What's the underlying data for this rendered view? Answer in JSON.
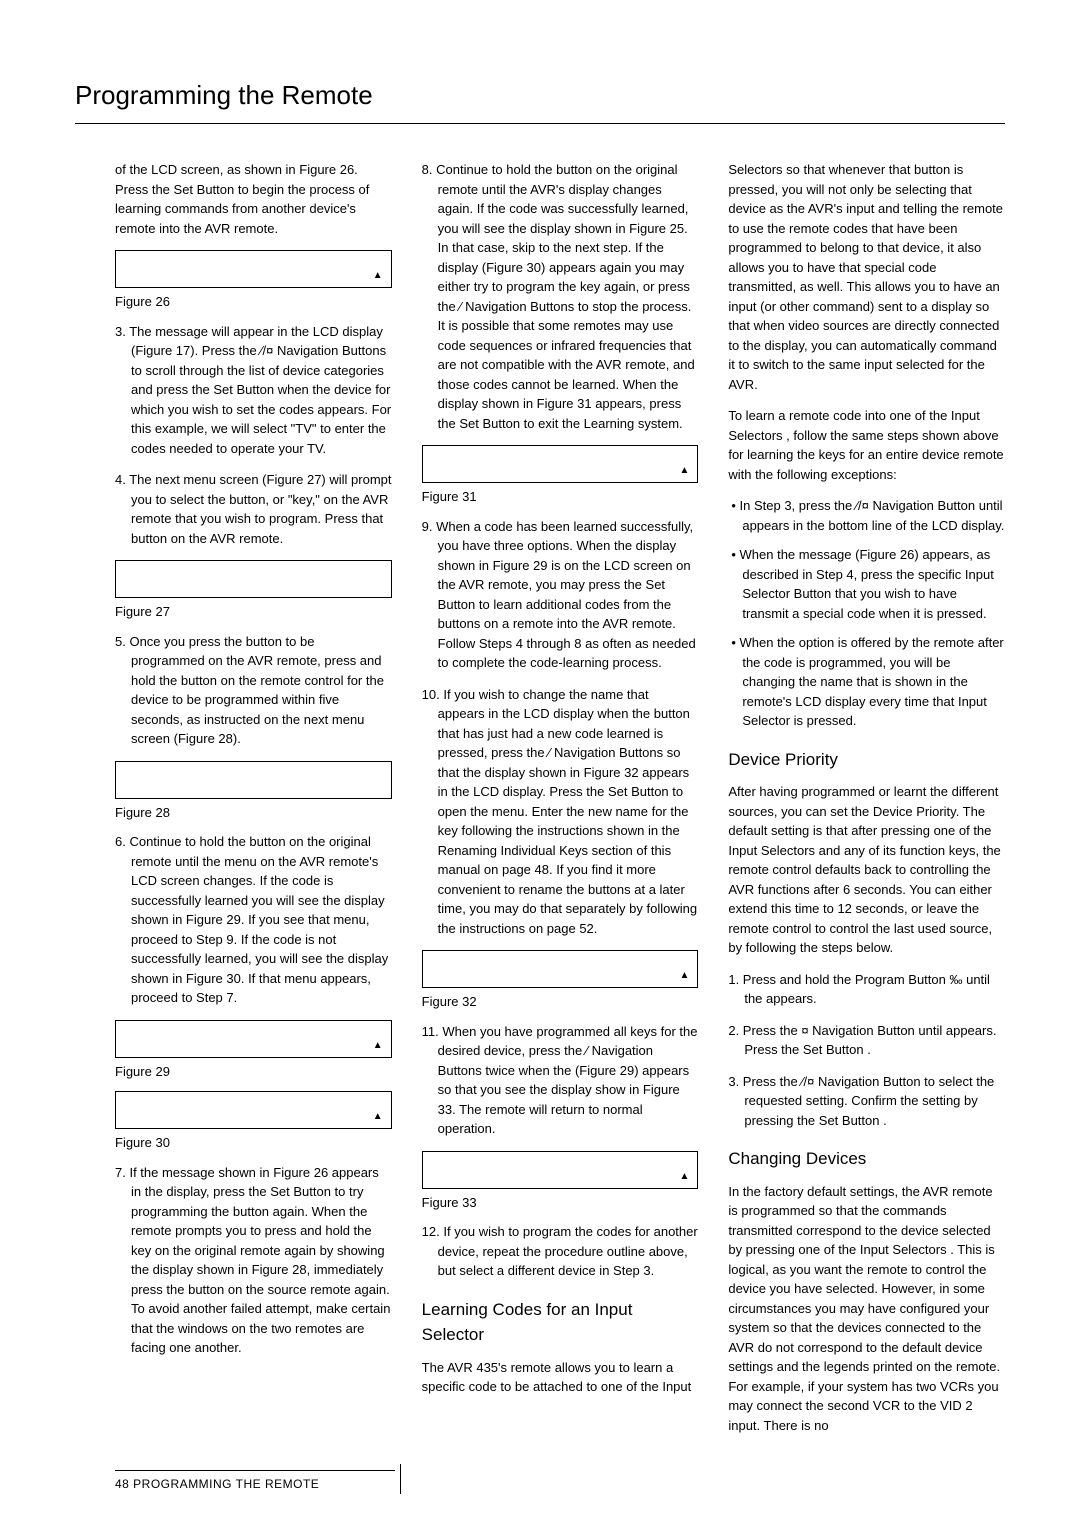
{
  "title": "Programming the Remote",
  "footer": "48  PROGRAMMING THE REMOTE",
  "col1": {
    "p0": "of the LCD screen, as shown in Figure 26. Press the Set Button        to begin the process of learning commands from another device's remote into the AVR remote.",
    "fig26": "Figure 26",
    "s3": "3. The                                message will appear in the LCD display (Figure 17). Press the ⁄/¤ Navigation Buttons        to scroll through the list of device categories and press the Set Button        when the device for which you wish to set the codes appears. For this example, we will select \"TV\" to enter the codes needed to operate your TV.",
    "s4": "4. The next menu screen (Figure 27) will prompt you to select the button, or \"key,\" on the AVR remote that you wish to program. Press that button on the AVR remote.",
    "fig27": "Figure 27",
    "s5": "5. Once you press the button to be programmed on the AVR remote, press and hold the button on the remote control for the device to be programmed within five seconds, as instructed on the next menu screen (Figure 28).",
    "fig28": "Figure 28",
    "s6": "6. Continue to hold the button on the original remote until the menu on the AVR remote's LCD screen changes. If the code is successfully learned you will see the display shown in Figure 29. If you see that menu, proceed to Step 9. If the code is not successfully learned, you will see the display shown in Figure 30. If that menu appears, proceed to Step 7.",
    "fig29": "Figure 29",
    "fig30": "Figure 30",
    "s7": "7. If the message shown in Figure 26 appears in the display, press the Set Button        to try programming the button again. When the remote prompts you to press and hold the key on the original remote again by showing the display shown in Figure 28, immediately press the button on the source remote again. To avoid another failed attempt, make certain that the windows on the two remotes are facing one another."
  },
  "col2": {
    "s8": "8. Continue to hold the button on the original remote until the AVR's display changes again. If the code was successfully learned, you will see the display shown in Figure 25. In that case, skip to the next step. If the                         display (Figure 30) appears again you may either try to program the key again, or press the ⁄ Navigation Buttons        to stop the process. It is possible that some remotes may use code sequences or infrared frequencies that are not compatible with the AVR remote, and those codes cannot be learned. When the display shown in Figure 31 appears, press the Set Button        to exit the Learning system.",
    "fig31": "Figure 31",
    "s9": "9. When a code has been learned successfully, you have three options. When the display shown in Figure 29 is on the LCD screen on the AVR remote, you may press the Set Button        to learn additional codes from the buttons on a remote into the AVR remote. Follow Steps 4 through 8 as often as needed to complete the code-learning process.",
    "s10": "10. If you wish to change the name that appears in the LCD display when the button that has just had a new code learned is pressed, press the ⁄ Navigation Buttons        so that the display shown in Figure 32 appears in the LCD display. Press the Set Button        to open the                         menu. Enter the new name for the key following the instructions shown in the Renaming Individual Keys section of this manual on page 48. If you find it more convenient to rename the buttons at a later time, you may do that separately by following the instructions on page 52.",
    "fig32": "Figure 32",
    "s11": "11. When you have programmed all keys for the desired device, press the ⁄ Navigation Buttons        twice when the                  (Figure 29) appears so that you see the display show in Figure 33. The remote will return to normal operation.",
    "fig33": "Figure 33",
    "s12": "12. If you wish to program the codes for another device, repeat the procedure outline above, but select a different device in Step 3.",
    "h2a": "Learning Codes for an Input Selector",
    "pA": "The AVR 435's remote allows you to learn a specific code to be attached to one of the Input"
  },
  "col3": {
    "p0": "Selectors        so that whenever that button is pressed, you will not only be selecting that device as the AVR's input and telling the remote to use the remote codes that have been programmed to belong to that device, it also allows you to have that special code transmitted, as well. This allows you to have an input (or other command) sent to a display so that when video sources are directly connected to the display, you can automatically command it to switch to the same input selected for the AVR.",
    "p1": "To learn a remote code into one of the Input Selectors       , follow the same steps shown above for learning the keys for an entire device remote with the following exceptions:",
    "b1": "In Step 3, press the ⁄/¤ Navigation Button        until                                          appears in the bottom line of the LCD display.",
    "b2": "When the                                          message (Figure 26) appears, as described in Step 4, press the specific Input Selector Button        that you wish to have transmit a special code when it is pressed.",
    "b3": "When the                                    option is offered by the remote after the code is programmed, you will be changing the name that is shown in the remote's LCD display every time that Input Selector is pressed.",
    "h2a": "Device Priority",
    "pA": "After having programmed or learnt the different sources, you can set the Device Priority. The default setting is that after pressing one of the Input Selectors and any of its function keys, the remote control defaults back to controlling the AVR functions after 6 seconds. You can either extend this time to 12 seconds, or leave the remote control to control the last used source, by following the steps below.",
    "s1": "1. Press and hold the Program Button ‰ until the                        appears.",
    "s2": "2. Press the ¤ Navigation Button        until                              appears. Press the Set Button       .",
    "s3": "3. Press the ⁄/¤ Navigation Button        to select the requested setting. Confirm the setting by pressing the Set Button       .",
    "h2b": "Changing Devices",
    "pB": "In the factory default settings, the AVR remote is programmed so that the commands transmitted correspond to the device selected by pressing one of the Input Selectors       . This is logical, as you want the remote to control the device you have selected. However, in some circumstances you may have configured your system so that the devices connected to the AVR do not correspond to the default device settings and the legends printed on the remote. For example, if your system has two VCRs you may connect the second VCR to the VID 2 input. There is no"
  }
}
